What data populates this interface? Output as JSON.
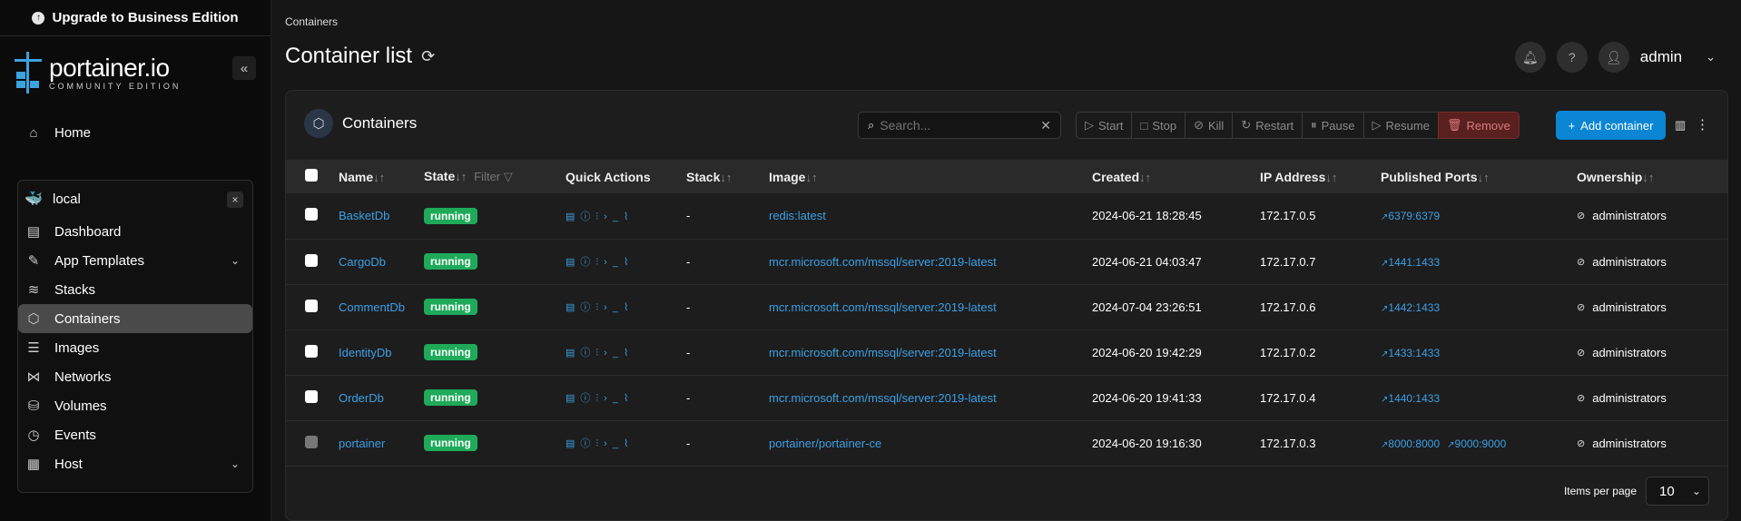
{
  "upgrade": {
    "label": "Upgrade to Business Edition"
  },
  "logo": {
    "brand": "portainer.io",
    "edition": "COMMUNITY EDITION"
  },
  "nav": {
    "home": "Home"
  },
  "environment": {
    "name": "local",
    "items": [
      {
        "label": "Dashboard",
        "icon": "dashboard-icon",
        "glyph": "▤"
      },
      {
        "label": "App Templates",
        "icon": "edit-icon",
        "glyph": "✎",
        "expandable": true
      },
      {
        "label": "Stacks",
        "icon": "layers-icon",
        "glyph": "≋"
      },
      {
        "label": "Containers",
        "icon": "cube-icon",
        "glyph": "⬡",
        "active": true
      },
      {
        "label": "Images",
        "icon": "list-icon",
        "glyph": "☰"
      },
      {
        "label": "Networks",
        "icon": "share-icon",
        "glyph": "⋈"
      },
      {
        "label": "Volumes",
        "icon": "database-icon",
        "glyph": "⛁"
      },
      {
        "label": "Events",
        "icon": "clock-icon",
        "glyph": "◷"
      },
      {
        "label": "Host",
        "icon": "host-icon",
        "glyph": "▦",
        "expandable": true
      }
    ]
  },
  "header": {
    "breadcrumb": "Containers",
    "title": "Container list",
    "user": "admin"
  },
  "panel": {
    "title": "Containers",
    "search_placeholder": "Search...",
    "actions": [
      {
        "label": "Start",
        "glyph": "▷"
      },
      {
        "label": "Stop",
        "glyph": "□"
      },
      {
        "label": "Kill",
        "glyph": "⊘"
      },
      {
        "label": "Restart",
        "glyph": "↻"
      },
      {
        "label": "Pause",
        "glyph": "⏸"
      },
      {
        "label": "Resume",
        "glyph": "▷"
      },
      {
        "label": "Remove",
        "glyph": "🗑"
      }
    ],
    "add_label": "Add container"
  },
  "table": {
    "headers": {
      "name": "Name",
      "state": "State",
      "filter": "Filter",
      "quick_actions": "Quick Actions",
      "stack": "Stack",
      "image": "Image",
      "created": "Created",
      "ip": "IP Address",
      "ports": "Published Ports",
      "ownership": "Ownership"
    },
    "rows": [
      {
        "name": "BasketDb",
        "state": "running",
        "stack": "-",
        "image": "redis:latest",
        "created": "2024-06-21 18:28:45",
        "ip": "172.17.0.5",
        "ports": [
          "6379:6379"
        ],
        "ownership": "administrators",
        "disabled": false
      },
      {
        "name": "CargoDb",
        "state": "running",
        "stack": "-",
        "image": "mcr.microsoft.com/mssql/server:2019-latest",
        "created": "2024-06-21 04:03:47",
        "ip": "172.17.0.7",
        "ports": [
          "1441:1433"
        ],
        "ownership": "administrators",
        "disabled": false
      },
      {
        "name": "CommentDb",
        "state": "running",
        "stack": "-",
        "image": "mcr.microsoft.com/mssql/server:2019-latest",
        "created": "2024-07-04 23:26:51",
        "ip": "172.17.0.6",
        "ports": [
          "1442:1433"
        ],
        "ownership": "administrators",
        "disabled": false
      },
      {
        "name": "IdentityDb",
        "state": "running",
        "stack": "-",
        "image": "mcr.microsoft.com/mssql/server:2019-latest",
        "created": "2024-06-20 19:42:29",
        "ip": "172.17.0.2",
        "ports": [
          "1433:1433"
        ],
        "ownership": "administrators",
        "disabled": false
      },
      {
        "name": "OrderDb",
        "state": "running",
        "stack": "-",
        "image": "mcr.microsoft.com/mssql/server:2019-latest",
        "created": "2024-06-20 19:41:33",
        "ip": "172.17.0.4",
        "ports": [
          "1440:1433"
        ],
        "ownership": "administrators",
        "disabled": false
      },
      {
        "name": "portainer",
        "state": "running",
        "stack": "-",
        "image": "portainer/portainer-ce",
        "created": "2024-06-20 19:16:30",
        "ip": "172.17.0.3",
        "ports": [
          "8000:8000",
          "9000:9000"
        ],
        "ownership": "administrators",
        "disabled": true
      }
    ]
  },
  "footer": {
    "items_per_page_label": "Items per page",
    "items_per_page_value": "10"
  },
  "colors": {
    "accent": "#3ba0e6",
    "running": "#1faa59",
    "remove": "#5a1f1f",
    "add": "#0a86d4"
  }
}
